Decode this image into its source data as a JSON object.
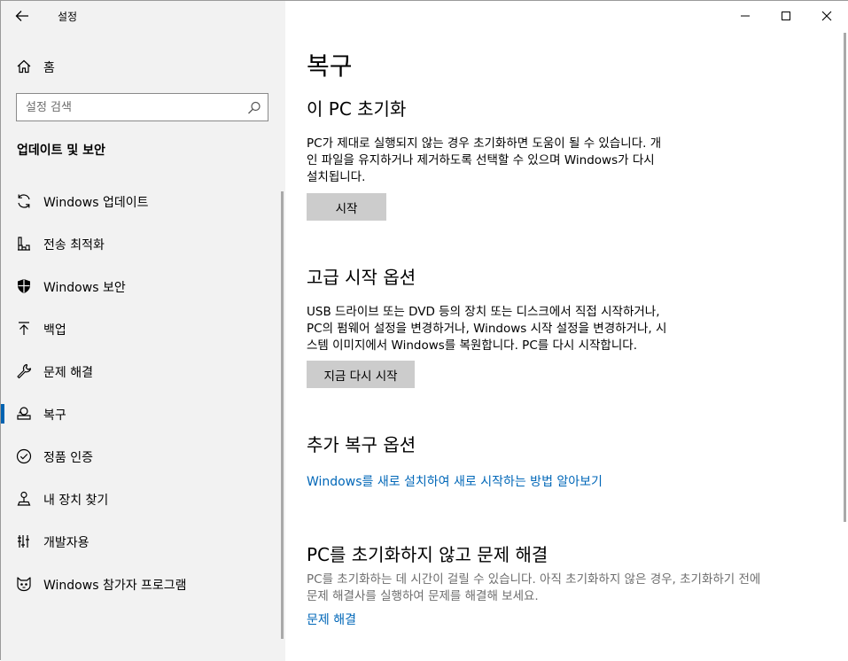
{
  "window": {
    "title": "설정",
    "controls": {
      "minimize": "minimize-icon",
      "maximize": "maximize-icon",
      "close": "close-icon"
    }
  },
  "sidebar": {
    "home_label": "홈",
    "search_placeholder": "설정 검색",
    "section_title": "업데이트 및 보안",
    "items": [
      {
        "label": "Windows 업데이트",
        "icon": "sync-icon"
      },
      {
        "label": "전송 최적화",
        "icon": "delivery-optimization-icon"
      },
      {
        "label": "Windows 보안",
        "icon": "shield-icon"
      },
      {
        "label": "백업",
        "icon": "backup-arrow-icon"
      },
      {
        "label": "문제 해결",
        "icon": "wrench-icon"
      },
      {
        "label": "복구",
        "icon": "recovery-icon",
        "selected": true
      },
      {
        "label": "정품 인증",
        "icon": "check-circle-icon"
      },
      {
        "label": "내 장치 찾기",
        "icon": "find-device-icon"
      },
      {
        "label": "개발자용",
        "icon": "developer-icon"
      },
      {
        "label": "Windows 참가자 프로그램",
        "icon": "insider-icon"
      }
    ]
  },
  "main": {
    "title": "복구",
    "reset": {
      "heading": "이 PC 초기화",
      "lines": [
        "PC가 제대로 실행되지 않는 경우 초기화하면 도움이 될 수 있습니다. 개",
        "인 파일을 유지하거나 제거하도록 선택할 수 있으며 Windows가 다시",
        "설치됩니다."
      ],
      "button": "시작"
    },
    "advanced": {
      "heading": "고급 시작 옵션",
      "lines": [
        "USB 드라이브 또는 DVD 등의 장치 또는 디스크에서 직접 시작하거나,",
        "PC의 펌웨어 설정을 변경하거나, Windows 시작 설정을 변경하거나, 시",
        "스템 이미지에서 Windows를 복원합니다. PC를 다시 시작합니다."
      ],
      "button": "지금 다시 시작"
    },
    "more": {
      "heading": "추가 복구 옵션",
      "link": "Windows를 새로 설치하여 새로 시작하는 방법 알아보기"
    },
    "troubleshoot": {
      "heading": "PC를 초기화하지 않고 문제 해결",
      "lines": [
        "PC를 초기화하는 데 시간이 걸릴 수 있습니다. 아직 초기화하지 않은 경우, 초기화하기 전에",
        "문제 해결사를 실행하여 문제를 해결해 보세요."
      ],
      "link": "문제 해결"
    }
  },
  "colors": {
    "accent": "#0063b1",
    "link": "#0067b8",
    "sidebar_bg": "#f2f2f2",
    "button_bg": "#cccccc"
  }
}
